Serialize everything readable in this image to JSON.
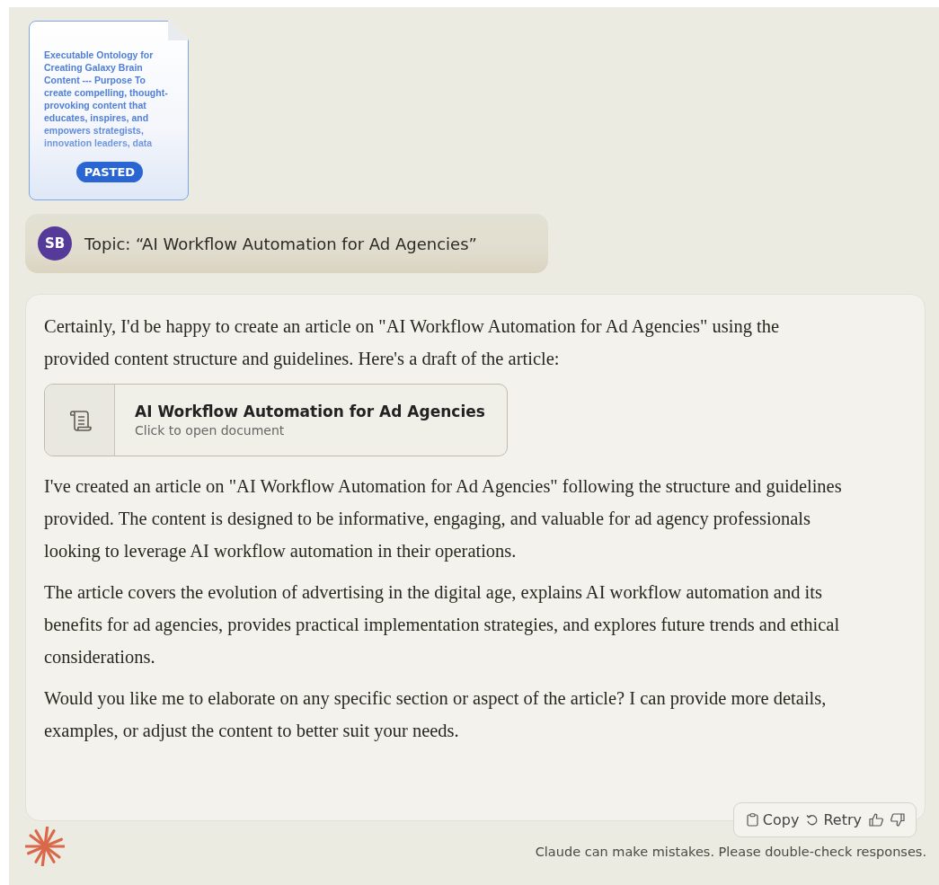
{
  "pasted_attachment": {
    "preview": "Executable Ontology for Creating Galaxy Brain Content --- Purpose To create compelling, thought-provoking content that educates, inspires, and empowers strategists, innovation leaders, data",
    "badge": "PASTED"
  },
  "user_message": {
    "avatar": "SB",
    "text": "Topic: “AI Workflow Automation for Ad Agencies”"
  },
  "assistant_message": {
    "paragraphs": [
      "Certainly, I'd be happy to create an article on \"AI Workflow Automation for Ad Agencies\" using the provided content structure and guidelines. Here's a draft of the article:"
    ],
    "artifact": {
      "title": "AI Workflow Automation for Ad Agencies",
      "subtitle": "Click to open document"
    },
    "paragraphs_after": [
      "I've created an article on \"AI Workflow Automation for Ad Agencies\" following the structure and guidelines provided. The content is designed to be informative, engaging, and valuable for ad agency professionals looking to leverage AI workflow automation in their operations.",
      "The article covers the evolution of advertising in the digital age, explains AI workflow automation and its benefits for ad agencies, provides practical implementation strategies, and explores future trends and ethical considerations.",
      "Would you like me to elaborate on any specific section or aspect of the article? I can provide more details, examples, or adjust the content to better suit your needs."
    ],
    "actions": [
      {
        "kind": "copy",
        "label": "Copy"
      },
      {
        "kind": "retry",
        "label": "Retry"
      },
      {
        "kind": "thumbs_up"
      },
      {
        "kind": "thumbs_down"
      }
    ]
  },
  "footer": {
    "disclaimer": "Claude can make mistakes. Please double-check responses."
  }
}
